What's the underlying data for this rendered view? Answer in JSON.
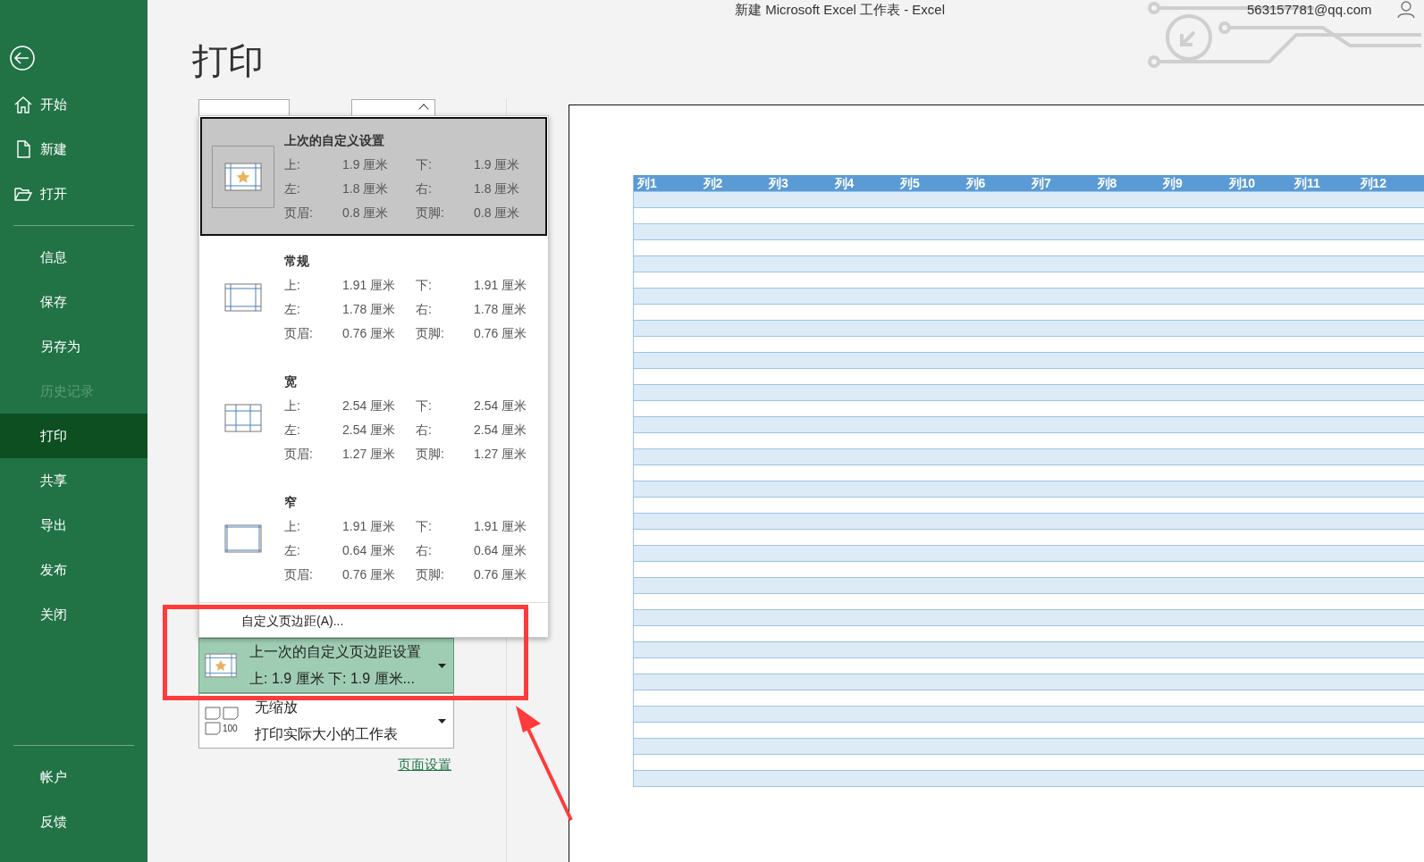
{
  "window": {
    "title": "新建 Microsoft Excel 工作表  -  Excel",
    "account": "563157781@qq.com"
  },
  "sidebar": {
    "groups": [
      [
        {
          "label": "开始",
          "selected": false,
          "disabled": false
        },
        {
          "label": "新建",
          "selected": false,
          "disabled": false
        },
        {
          "label": "打开",
          "selected": false,
          "disabled": false
        }
      ],
      [
        {
          "label": "信息",
          "selected": false,
          "disabled": false
        },
        {
          "label": "保存",
          "selected": false,
          "disabled": false
        },
        {
          "label": "另存为",
          "selected": false,
          "disabled": false
        },
        {
          "label": "历史记录",
          "selected": false,
          "disabled": true
        },
        {
          "label": "打印",
          "selected": true,
          "disabled": false
        },
        {
          "label": "共享",
          "selected": false,
          "disabled": false
        },
        {
          "label": "导出",
          "selected": false,
          "disabled": false
        },
        {
          "label": "发布",
          "selected": false,
          "disabled": false
        },
        {
          "label": "关闭",
          "selected": false,
          "disabled": false
        }
      ],
      [
        {
          "label": "帐户",
          "selected": false,
          "disabled": false
        },
        {
          "label": "反馈",
          "selected": false,
          "disabled": false
        }
      ]
    ]
  },
  "page_title": "打印",
  "margins_menu": {
    "options": [
      {
        "name": "上次的自定义设置",
        "selected": true,
        "kind": "custom",
        "rows": [
          [
            "上:",
            "1.9 厘米",
            "下:",
            "1.9 厘米"
          ],
          [
            "左:",
            "1.8 厘米",
            "右:",
            "1.8 厘米"
          ],
          [
            "页眉:",
            "0.8 厘米",
            "页脚:",
            "0.8 厘米"
          ]
        ]
      },
      {
        "name": "常规",
        "selected": false,
        "kind": "normal",
        "rows": [
          [
            "上:",
            "1.91 厘米",
            "下:",
            "1.91 厘米"
          ],
          [
            "左:",
            "1.78 厘米",
            "右:",
            "1.78 厘米"
          ],
          [
            "页眉:",
            "0.76 厘米",
            "页脚:",
            "0.76 厘米"
          ]
        ]
      },
      {
        "name": "宽",
        "selected": false,
        "kind": "wide",
        "rows": [
          [
            "上:",
            "2.54 厘米",
            "下:",
            "2.54 厘米"
          ],
          [
            "左:",
            "2.54 厘米",
            "右:",
            "2.54 厘米"
          ],
          [
            "页眉:",
            "1.27 厘米",
            "页脚:",
            "1.27 厘米"
          ]
        ]
      },
      {
        "name": "窄",
        "selected": false,
        "kind": "narrow",
        "rows": [
          [
            "上:",
            "1.91 厘米",
            "下:",
            "1.91 厘米"
          ],
          [
            "左:",
            "0.64 厘米",
            "右:",
            "0.64 厘米"
          ],
          [
            "页眉:",
            "0.76 厘米",
            "页脚:",
            "0.76 厘米"
          ]
        ]
      }
    ],
    "footer": "自定义页边距(A)..."
  },
  "settings": [
    {
      "kind": "margins",
      "title": "上一次的自定义页边距设置",
      "subtitle": "上: 1.9 厘米 下: 1.9 厘米...",
      "highlighted": true
    },
    {
      "kind": "scaling",
      "title": "无缩放",
      "subtitle": "打印实际大小的工作表",
      "highlighted": false,
      "icon_text": "100"
    }
  ],
  "page_setup_link": "页面设置",
  "preview": {
    "columns": [
      "列1",
      "列2",
      "列3",
      "列4",
      "列5",
      "列6",
      "列7",
      "列8",
      "列9",
      "列10",
      "列11",
      "列12"
    ]
  }
}
